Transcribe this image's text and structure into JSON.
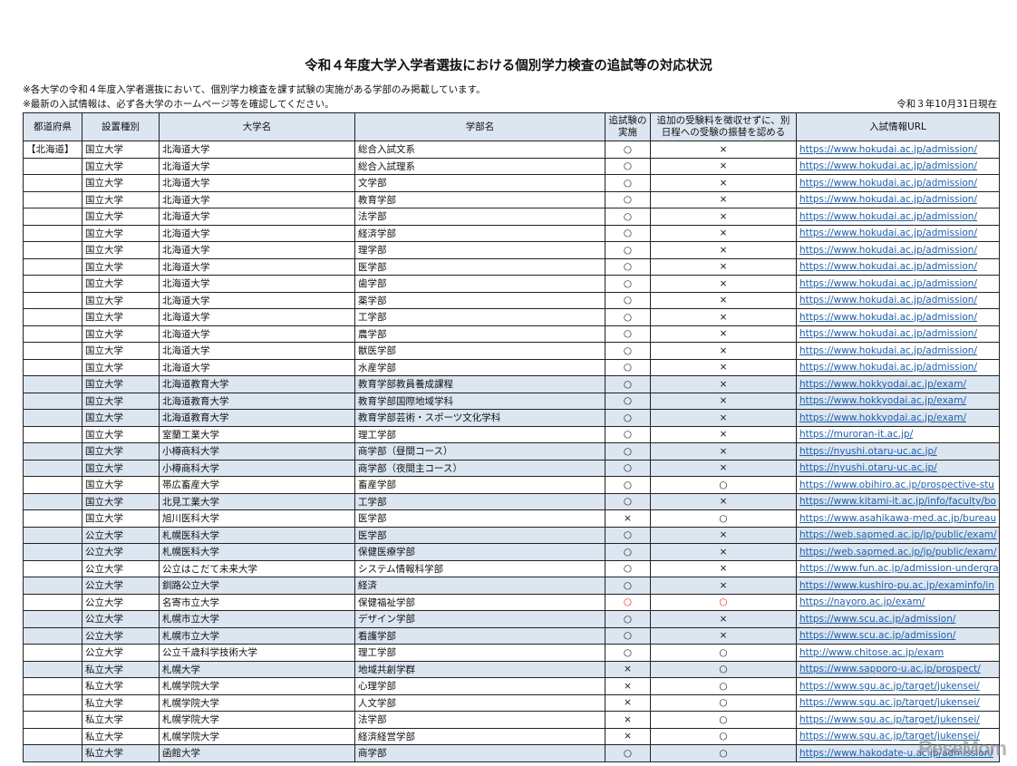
{
  "title": "令和４年度大学入学者選抜における個別学力検査の追試等の対応状況",
  "notes": [
    "※各大学の令和４年度入学者選抜において、個別学力検査を課す試験の実施がある学部のみ掲載しています。",
    "※最新の入試情報は、必ず各大学のホームページ等を確認してください。"
  ],
  "as_of": "令和３年10月31日現在",
  "headers": [
    "都道府県",
    "設置種別",
    "大学名",
    "学部名",
    "追試験の実施",
    "追加の受験料を徴収せずに、別日程への受験の振替を認める",
    "入試情報URL"
  ],
  "rows": [
    [
      "【北海道】",
      "国立大学",
      "北海道大学",
      "総合入試文系",
      "○",
      "×",
      "https://www.hokudai.ac.jp/admission/",
      0
    ],
    [
      "",
      "国立大学",
      "北海道大学",
      "総合入試理系",
      "○",
      "×",
      "https://www.hokudai.ac.jp/admission/",
      0
    ],
    [
      "",
      "国立大学",
      "北海道大学",
      "文学部",
      "○",
      "×",
      "https://www.hokudai.ac.jp/admission/",
      0
    ],
    [
      "",
      "国立大学",
      "北海道大学",
      "教育学部",
      "○",
      "×",
      "https://www.hokudai.ac.jp/admission/",
      0
    ],
    [
      "",
      "国立大学",
      "北海道大学",
      "法学部",
      "○",
      "×",
      "https://www.hokudai.ac.jp/admission/",
      0
    ],
    [
      "",
      "国立大学",
      "北海道大学",
      "経済学部",
      "○",
      "×",
      "https://www.hokudai.ac.jp/admission/",
      0
    ],
    [
      "",
      "国立大学",
      "北海道大学",
      "理学部",
      "○",
      "×",
      "https://www.hokudai.ac.jp/admission/",
      0
    ],
    [
      "",
      "国立大学",
      "北海道大学",
      "医学部",
      "○",
      "×",
      "https://www.hokudai.ac.jp/admission/",
      0
    ],
    [
      "",
      "国立大学",
      "北海道大学",
      "歯学部",
      "○",
      "×",
      "https://www.hokudai.ac.jp/admission/",
      0
    ],
    [
      "",
      "国立大学",
      "北海道大学",
      "薬学部",
      "○",
      "×",
      "https://www.hokudai.ac.jp/admission/",
      0
    ],
    [
      "",
      "国立大学",
      "北海道大学",
      "工学部",
      "○",
      "×",
      "https://www.hokudai.ac.jp/admission/",
      0
    ],
    [
      "",
      "国立大学",
      "北海道大学",
      "農学部",
      "○",
      "×",
      "https://www.hokudai.ac.jp/admission/",
      0
    ],
    [
      "",
      "国立大学",
      "北海道大学",
      "獣医学部",
      "○",
      "×",
      "https://www.hokudai.ac.jp/admission/",
      0
    ],
    [
      "",
      "国立大学",
      "北海道大学",
      "水産学部",
      "○",
      "×",
      "https://www.hokudai.ac.jp/admission/",
      0
    ],
    [
      "",
      "国立大学",
      "北海道教育大学",
      "教育学部教員養成課程",
      "○",
      "×",
      "https://www.hokkyodai.ac.jp/exam/",
      1
    ],
    [
      "",
      "国立大学",
      "北海道教育大学",
      "教育学部国際地域学科",
      "○",
      "×",
      "https://www.hokkyodai.ac.jp/exam/",
      1
    ],
    [
      "",
      "国立大学",
      "北海道教育大学",
      "教育学部芸術・スポーツ文化学科",
      "○",
      "×",
      "https://www.hokkyodai.ac.jp/exam/",
      1
    ],
    [
      "",
      "国立大学",
      "室蘭工業大学",
      "理工学部",
      "○",
      "×",
      "https://muroran-it.ac.jp/",
      0
    ],
    [
      "",
      "国立大学",
      "小樽商科大学",
      "商学部（昼間コース）",
      "○",
      "×",
      "https://nyushi.otaru-uc.ac.jp/",
      1
    ],
    [
      "",
      "国立大学",
      "小樽商科大学",
      "商学部（夜間主コース）",
      "○",
      "×",
      "https://nyushi.otaru-uc.ac.jp/",
      1
    ],
    [
      "",
      "国立大学",
      "帯広畜産大学",
      "畜産学部",
      "○",
      "○",
      "https://www.obihiro.ac.jp/prospective-stu",
      0
    ],
    [
      "",
      "国立大学",
      "北見工業大学",
      "工学部",
      "○",
      "×",
      "https://www.kitami-it.ac.jp/info/faculty/bo",
      1
    ],
    [
      "",
      "国立大学",
      "旭川医科大学",
      "医学部",
      "×",
      "○",
      "https://www.asahikawa-med.ac.jp/bureau",
      0
    ],
    [
      "",
      "公立大学",
      "札幌医科大学",
      "医学部",
      "○",
      "×",
      "https://web.sapmed.ac.jp/jp/public/exam/",
      1
    ],
    [
      "",
      "公立大学",
      "札幌医科大学",
      "保健医療学部",
      "○",
      "×",
      "https://web.sapmed.ac.jp/jp/public/exam/",
      1
    ],
    [
      "",
      "公立大学",
      "公立はこだて未来大学",
      "システム情報科学部",
      "○",
      "×",
      "https://www.fun.ac.jp/admission-undergra",
      0
    ],
    [
      "",
      "公立大学",
      "釧路公立大学",
      "経済",
      "○",
      "×",
      "https://www.kushiro-pu.ac.jp/examinfo/in",
      1
    ],
    [
      "",
      "公立大学",
      "名寄市立大学",
      "保健福祉学部",
      "○",
      "○",
      "https://nayoro.ac.jp/exam/",
      0,
      "red"
    ],
    [
      "",
      "公立大学",
      "札幌市立大学",
      "デザイン学部",
      "○",
      "×",
      "https://www.scu.ac.jp/admission/",
      1
    ],
    [
      "",
      "公立大学",
      "札幌市立大学",
      "看護学部",
      "○",
      "×",
      "https://www.scu.ac.jp/admission/",
      1
    ],
    [
      "",
      "公立大学",
      "公立千歳科学技術大学",
      "理工学部",
      "○",
      "○",
      "http://www.chitose.ac.jp/exam",
      0
    ],
    [
      "",
      "私立大学",
      "札幌大学",
      "地域共創学群",
      "×",
      "○",
      "https://www.sapporo-u.ac.jp/prospect/",
      1
    ],
    [
      "",
      "私立大学",
      "札幌学院大学",
      "心理学部",
      "×",
      "○",
      "https://www.sgu.ac.jp/target/jukensei/",
      0
    ],
    [
      "",
      "私立大学",
      "札幌学院大学",
      "人文学部",
      "×",
      "○",
      "https://www.sgu.ac.jp/target/jukensei/",
      0
    ],
    [
      "",
      "私立大学",
      "札幌学院大学",
      "法学部",
      "×",
      "○",
      "https://www.sgu.ac.jp/target/jukensei/",
      0
    ],
    [
      "",
      "私立大学",
      "札幌学院大学",
      "経済経営学部",
      "×",
      "○",
      "https://www.sgu.ac.jp/target/jukensei/",
      0
    ],
    [
      "",
      "私立大学",
      "函館大学",
      "商学部",
      "○",
      "○",
      "https://www.hakodate-u.ac.jp/admission/",
      1
    ]
  ],
  "colors": {
    "header_bg": "#dce6f1",
    "shade_bg": "#dce6f1",
    "link": "#1f5fa8",
    "highlight": "#e02020"
  },
  "watermark": "ReseMom"
}
